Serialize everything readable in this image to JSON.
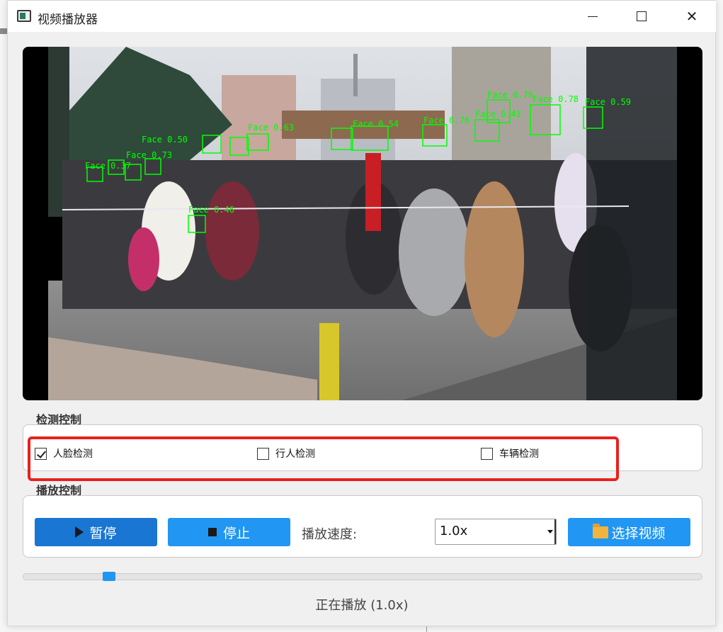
{
  "window": {
    "title": "视频播放器",
    "close_glyph": "✕"
  },
  "video": {
    "detections": [
      {
        "label": "Face 0.78"
      },
      {
        "label": "Face 0.78"
      },
      {
        "label": "Face 0.59"
      },
      {
        "label": "Face 0.78"
      },
      {
        "label": "Face 0.41"
      },
      {
        "label": "Face 0.63"
      },
      {
        "label": "Face 0.50"
      },
      {
        "label": "Face 0.54"
      },
      {
        "label": "Face 0.73"
      },
      {
        "label": "Face 0.46"
      },
      {
        "label": "Face 0.37"
      }
    ]
  },
  "detection_control": {
    "group_label": "检测控制",
    "options": [
      {
        "label": "人脸检测",
        "checked": true
      },
      {
        "label": "行人检测",
        "checked": false
      },
      {
        "label": "车辆检测",
        "checked": false
      }
    ]
  },
  "playback_control": {
    "group_label": "播放控制",
    "pause_label": "暂停",
    "stop_label": "停止",
    "speed_label": "播放速度:",
    "speed_value": "1.0x",
    "open_label": "选择视频"
  },
  "progress": {
    "fraction": 0.12
  },
  "status": {
    "text": "正在播放 (1.0x)"
  },
  "colors": {
    "primary": "#1976d2",
    "button": "#2196f3",
    "highlight": "#e8211c",
    "detection_box": "#00ff00"
  }
}
